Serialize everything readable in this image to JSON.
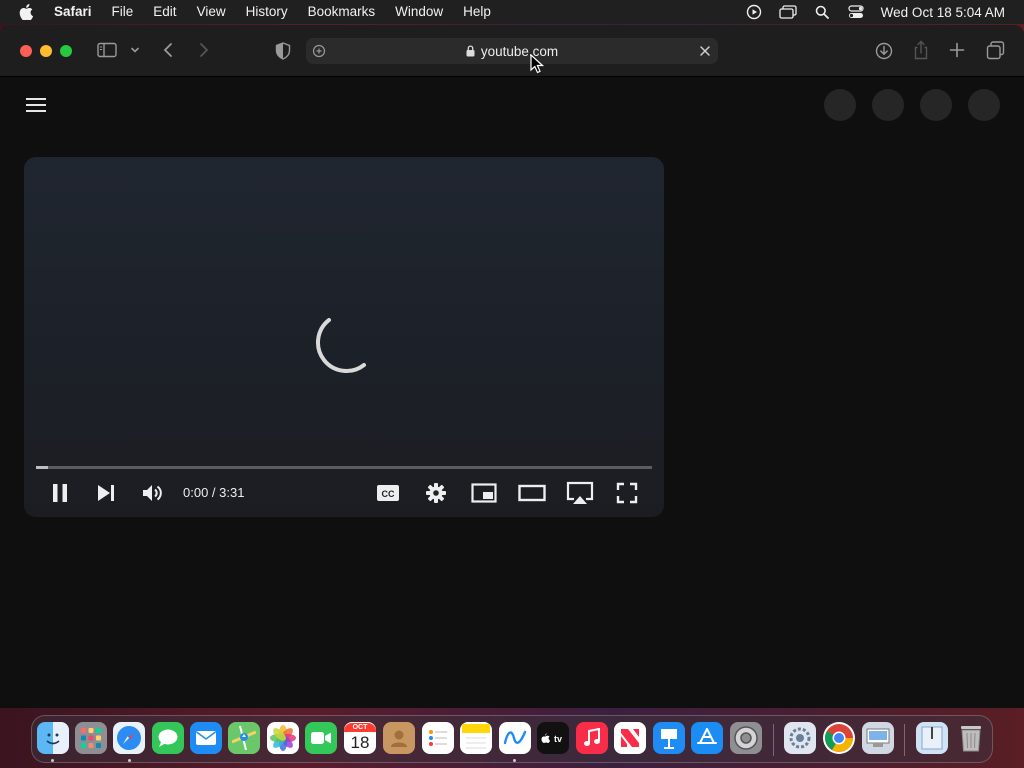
{
  "menubar": {
    "app_name": "Safari",
    "items": [
      "File",
      "Edit",
      "View",
      "History",
      "Bookmarks",
      "Window",
      "Help"
    ],
    "clock": "Wed Oct 18  5:04 AM"
  },
  "browser": {
    "url": "youtube.com"
  },
  "player": {
    "time": "0:00 / 3:31",
    "progress_fraction": 0.0
  },
  "dock": {
    "calendar_month": "OCT",
    "calendar_day": "18",
    "apps": [
      "Finder",
      "Launchpad",
      "Safari",
      "Messages",
      "Mail",
      "Maps",
      "Photos",
      "FaceTime",
      "Calendar",
      "Contacts",
      "Reminders",
      "Notes",
      "Freeform",
      "TV",
      "Music",
      "News",
      "Keynote",
      "App Store",
      "System Settings",
      "Utility",
      "Chrome",
      "Preview",
      "Downloads",
      "Trash"
    ]
  },
  "colors": {
    "close": "#ff5f57",
    "minimize": "#febc2e",
    "maximize": "#28c840",
    "youtube_red": "#ff0000"
  }
}
